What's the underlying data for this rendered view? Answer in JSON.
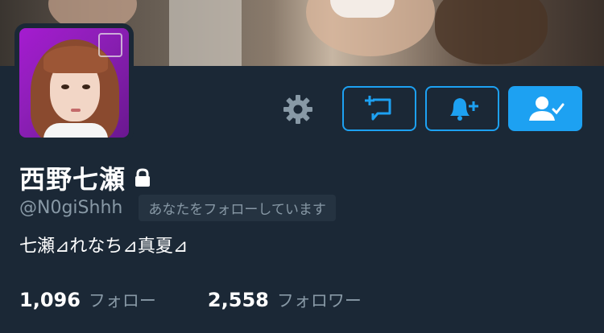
{
  "profile": {
    "name": "西野七瀬",
    "handle": "@N0giShhh",
    "follows_you_badge": "あなたをフォローしています",
    "bio": "七瀬⊿れなち⊿真夏⊿",
    "protected": true
  },
  "stats": {
    "following_count": "1,096",
    "following_label": "フォロー",
    "followers_count": "2,558",
    "followers_label": "フォロワー"
  },
  "icons": {
    "settings": "gear-icon",
    "direct_message": "message-plus-icon",
    "notifications": "bell-plus-icon",
    "following": "user-check-icon",
    "protected": "lock-icon"
  },
  "colors": {
    "background": "#1b2836",
    "accent": "#1da1f2",
    "secondary_text": "#8899a6",
    "badge_bg": "#253341"
  }
}
